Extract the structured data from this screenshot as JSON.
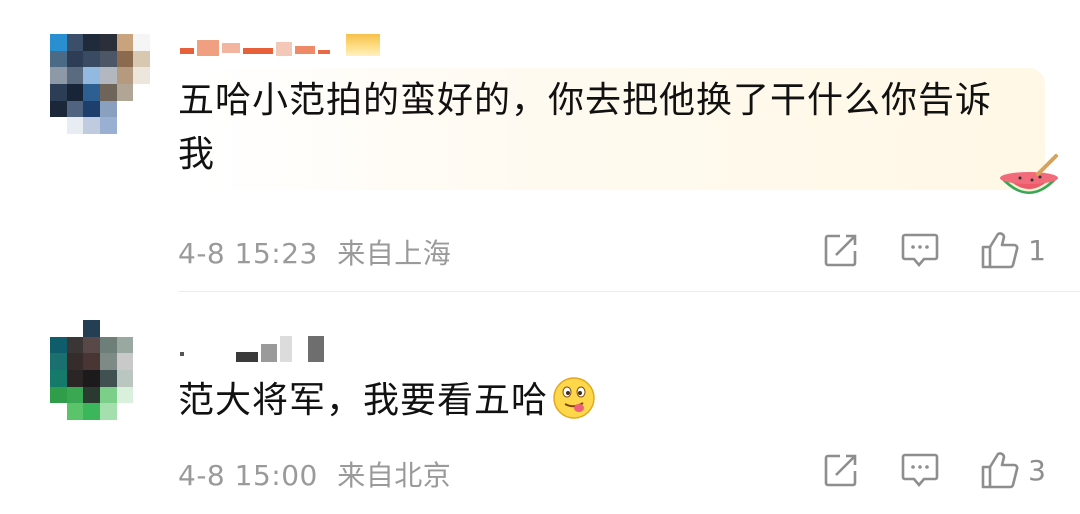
{
  "comments": [
    {
      "text_line1": "五哈小范拍的蛮好的，你去把他换了干什么你告诉",
      "text_line2": "我",
      "timestamp": "4-8 15:23",
      "location": "来自上海",
      "like_count": "1",
      "sticker": "watermelon-sticker"
    },
    {
      "text": "范大将军，我要看五哈",
      "timestamp": "4-8 15:00",
      "location": "来自北京",
      "like_count": "3",
      "sticker": "tongue-out-emoji"
    }
  ],
  "icons": {
    "share": "share-icon",
    "reply": "comment-icon",
    "like": "thumbs-up-icon"
  },
  "colors": {
    "text": "#111111",
    "meta": "#9a9a9a",
    "icon": "#8e8e8e"
  }
}
